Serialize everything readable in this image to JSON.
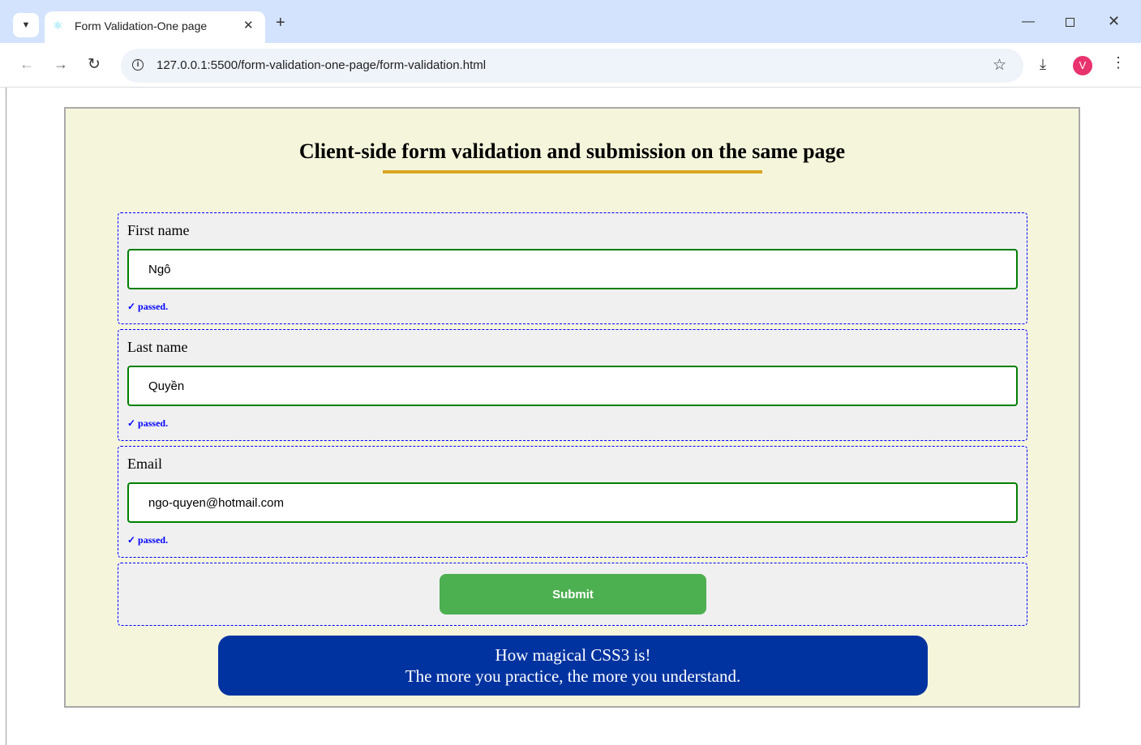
{
  "browser": {
    "tab_title": "Form Validation-One page",
    "tab_icons": {
      "favicon": "react-atom-icon",
      "close": "close-icon",
      "new_tab": "plus-icon",
      "tab_menu": "chevron-down-icon"
    },
    "url": "127.0.0.1:5500/form-validation-one-page/form-validation.html",
    "avatar_letter": "V",
    "avatar_color": "#e8336f",
    "tab_strip_color": "#d3e3fd"
  },
  "form": {
    "heading": "Client-side form validation and submission on the same page",
    "fields": [
      {
        "label": "First name",
        "value": "Ngô",
        "status": "✓ passed."
      },
      {
        "label": "Last name",
        "value": "Quyền",
        "status": "✓ passed."
      },
      {
        "label": "Email",
        "value": "ngo-quyen@hotmail.com",
        "status": "✓ passed."
      }
    ],
    "submit_label": "Submit",
    "colors": {
      "container_bg": "#f5f5dc",
      "underline": "#daa520",
      "input_border": "#008000",
      "status_text": "#0000ff",
      "submit_bg": "#4caf50",
      "banner_bg": "#0033a0"
    }
  },
  "banner": {
    "line1": "How magical CSS3 is!",
    "line2": "The more you practice, the more you understand."
  }
}
